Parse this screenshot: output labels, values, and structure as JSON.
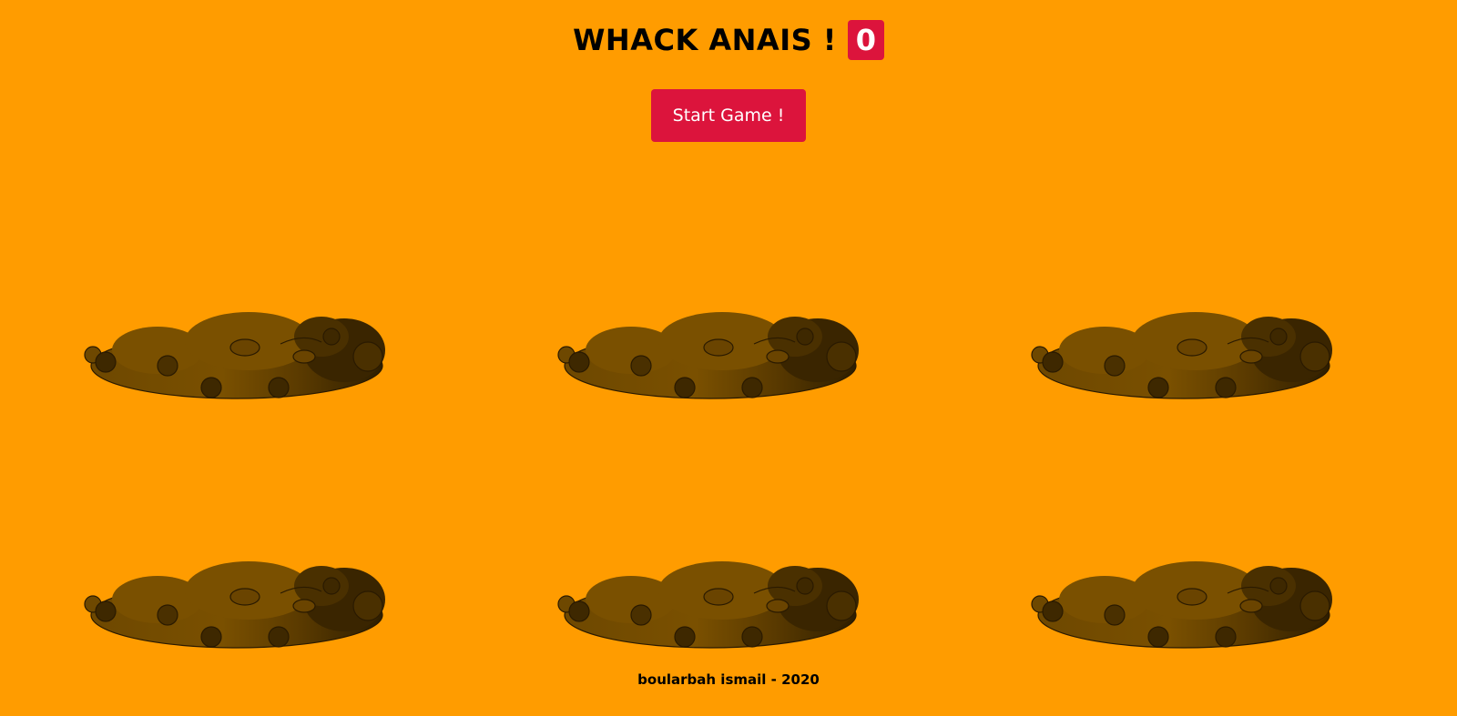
{
  "header": {
    "title": "WHACK ANAIS !",
    "score": "0"
  },
  "controls": {
    "start_label": "Start Game !"
  },
  "board": {
    "rows": 2,
    "cols": 3,
    "hole_count": 6
  },
  "footer": {
    "credit": "boularbah ismail - 2020"
  },
  "colors": {
    "background": "#ff9c00",
    "accent": "#dc143c",
    "dirt_light": "#7a5000",
    "dirt_dark": "#3a2500"
  }
}
